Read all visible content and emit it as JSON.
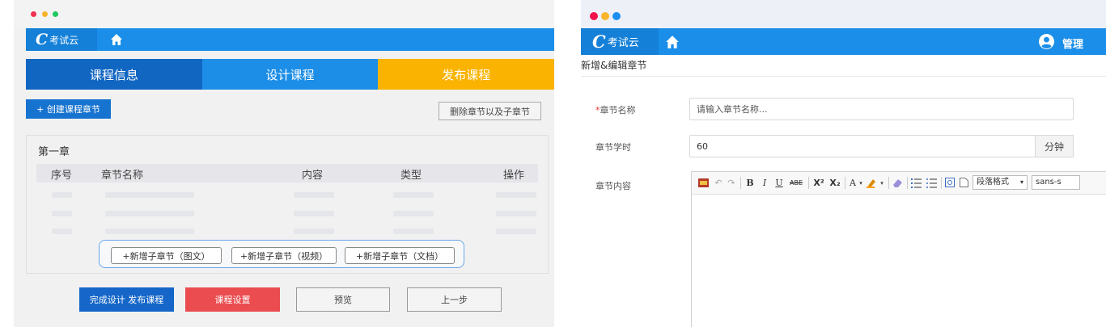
{
  "left": {
    "app_name": "考试云",
    "logo_glyph": "C",
    "steps": [
      "课程信息",
      "设计课程",
      "发布课程"
    ],
    "create_chapter": "+ 创建课程章节",
    "delete_chapter": "删除章节以及子章节",
    "chapter_title": "第一章",
    "columns": [
      "序号",
      "章节名称",
      "内容",
      "类型",
      "操作"
    ],
    "sub_buttons": [
      "+新增子章节（图文）",
      "+新增子章节（视频）",
      "+新增子章节（文档）"
    ],
    "bottom_buttons": [
      "完成设计 发布课程",
      "课程设置",
      "预览",
      "上一步"
    ],
    "colors": {
      "primary": "#1a8ee8",
      "step_active": "#1c8ee8",
      "step_done": "#1166c2",
      "step_next": "#f9b300",
      "danger": "#ea4c4f"
    }
  },
  "right": {
    "app_name": "考试云",
    "logo_glyph": "C",
    "manage": "管理",
    "form_title": "新增&编辑章节",
    "name_label_req": "*",
    "name_label": "章节名称",
    "name_placeholder": "请输入章节名称...",
    "hours_label": "章节学时",
    "hours_value": "60",
    "hours_unit": "分钟",
    "content_label": "章节内容",
    "toolbar": {
      "bold": "B",
      "italic": "I",
      "underline": "U",
      "strike": "ABE",
      "superscript": "X²",
      "subscript": "X₂",
      "font_color": "A",
      "paragraph_format": "段落格式",
      "font_family": "sans-s"
    }
  }
}
